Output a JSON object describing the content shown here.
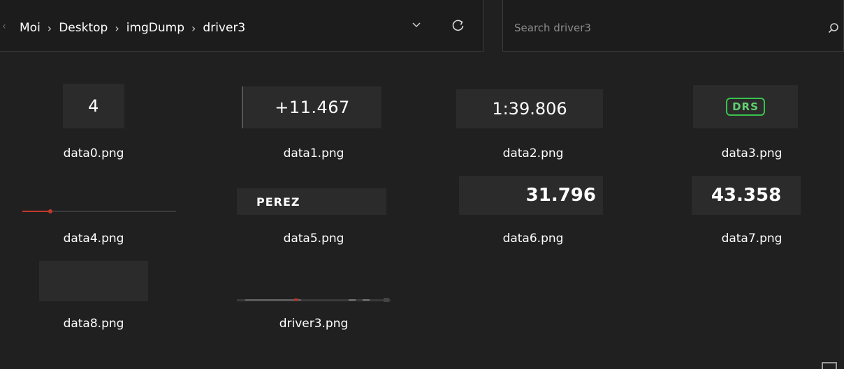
{
  "addressbar": {
    "breadcrumbs": [
      "Moi",
      "Desktop",
      "imgDump",
      "driver3"
    ],
    "separator": "›"
  },
  "search": {
    "placeholder": "Search driver3"
  },
  "files": [
    {
      "name": "data0.png",
      "thumb_text": "4"
    },
    {
      "name": "data1.png",
      "thumb_text": "+11.467"
    },
    {
      "name": "data2.png",
      "thumb_text": "1:39.806"
    },
    {
      "name": "data3.png",
      "thumb_text": "DRS"
    },
    {
      "name": "data4.png",
      "thumb_text": ""
    },
    {
      "name": "data5.png",
      "thumb_text": "PEREZ"
    },
    {
      "name": "data6.png",
      "thumb_text": "31.796"
    },
    {
      "name": "data7.png",
      "thumb_text": "43.358"
    },
    {
      "name": "data8.png",
      "thumb_text": ""
    },
    {
      "name": "driver3.png",
      "thumb_text": ""
    }
  ],
  "colors": {
    "background": "#202020",
    "thumb_bg": "#2b2b2b",
    "drs_green": "#39c24d",
    "red_line": "#c0392b"
  }
}
